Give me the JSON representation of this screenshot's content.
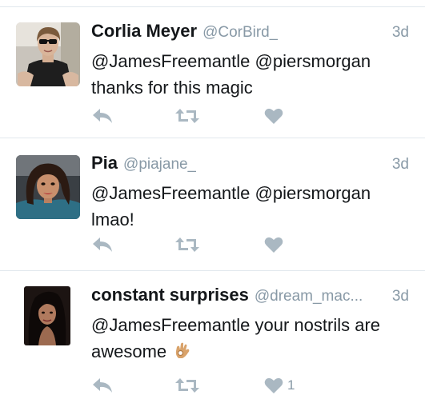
{
  "colors": {
    "name": "#14171a",
    "meta": "#8899a6",
    "icon": "#aab8c2",
    "divider": "#e1e8ed"
  },
  "tweets": [
    {
      "name": "Corlia Meyer",
      "handle": "@CorBird_",
      "time": "3d",
      "line1": "@JamesFreemantle @piersmorgan",
      "line2": "thanks for this magic",
      "like_count": "",
      "avatar": "woman-sunglasses-avatar"
    },
    {
      "name": "Pia",
      "handle": "@piajane_",
      "time": "3d",
      "line1": "@JamesFreemantle @piersmorgan",
      "line2": "lmao!",
      "like_count": "",
      "avatar": "woman-selfie-avatar"
    },
    {
      "name": "constant surprises",
      "handle": "@dream_mac...",
      "time": "3d",
      "line1": "@JamesFreemantle your nostrils are",
      "line2": "awesome",
      "emoji": "ok-hand-emoji",
      "like_count": "1",
      "avatar": "woman-dark-hair-avatar"
    }
  ],
  "icons": {
    "reply": "reply-icon",
    "retweet": "retweet-icon",
    "like": "heart-icon"
  }
}
